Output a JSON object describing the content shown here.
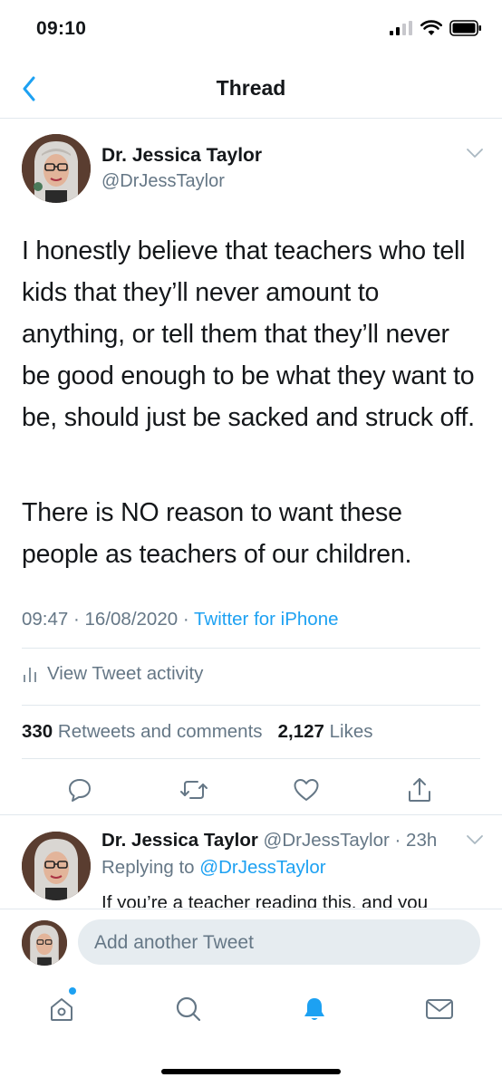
{
  "status_bar": {
    "time": "09:10"
  },
  "nav": {
    "title": "Thread"
  },
  "tweet": {
    "author_name": "Dr. Jessica Taylor",
    "author_handle": "@DrJessTaylor",
    "paragraph1": "I honestly believe that teachers who tell kids that they’ll never amount to anything, or tell them that they’ll never be good enough to be what they want to be, should just be sacked and struck off.",
    "paragraph2": "There is NO reason to want these people as teachers of our children.",
    "time": "09:47",
    "date": "16/08/2020",
    "source": "Twitter for iPhone",
    "activity_label": "View Tweet activity",
    "retweets_count": "330",
    "retweets_label": "Retweets and comments",
    "likes_count": "2,127",
    "likes_label": "Likes"
  },
  "reply": {
    "author_name": "Dr. Jessica Taylor",
    "author_handle": "@DrJessTaylor",
    "age": "23h",
    "replying_label": "Replying to",
    "replying_handle": "@DrJessTaylor",
    "text_preview": "If you’re a teacher reading this, and you"
  },
  "compose": {
    "placeholder": "Add another Tweet"
  },
  "icons": {
    "back": "chevron-left-icon",
    "menu": "chevron-down-icon",
    "reply": "comment-icon",
    "retweet": "retweet-icon",
    "like": "heart-icon",
    "share": "share-icon",
    "tabs": [
      "home-icon",
      "search-icon",
      "notifications-icon",
      "messages-icon"
    ]
  },
  "colors": {
    "accent": "#1da1f2",
    "secondary_text": "#657786",
    "divider": "#e1e8ed"
  }
}
